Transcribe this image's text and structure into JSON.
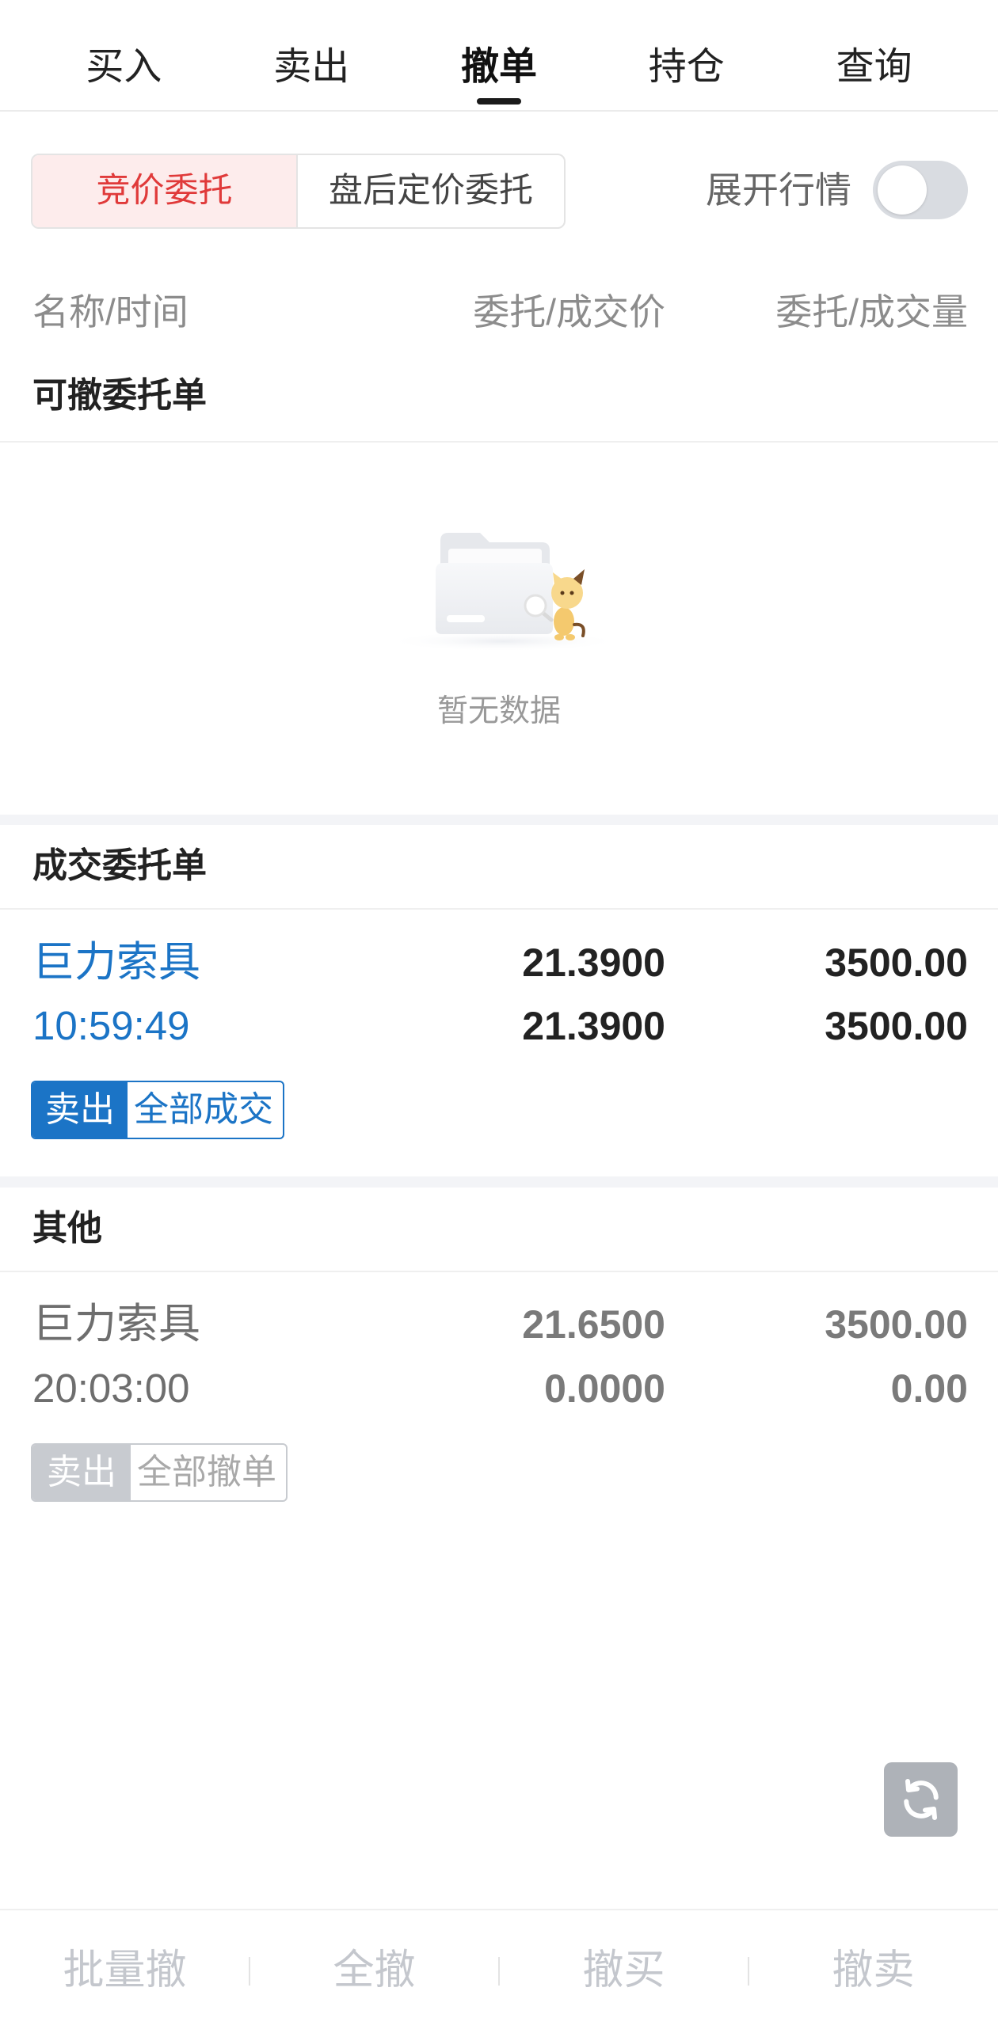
{
  "tabs": [
    {
      "label": "买入"
    },
    {
      "label": "卖出"
    },
    {
      "label": "撤单"
    },
    {
      "label": "持仓"
    },
    {
      "label": "查询"
    }
  ],
  "active_tab_index": 2,
  "order_type_segment": {
    "options": [
      "竞价委托",
      "盘后定价委托"
    ],
    "selected_index": 0
  },
  "market_toggle": {
    "label": "展开行情",
    "on": false
  },
  "columns": {
    "name_time": "名称/时间",
    "price": "委托/成交价",
    "volume": "委托/成交量"
  },
  "sections": {
    "cancelable": {
      "title": "可撤委托单",
      "empty_text": "暂无数据",
      "orders": []
    },
    "filled": {
      "title": "成交委托单",
      "orders": [
        {
          "name": "巨力索具",
          "time": "10:59:49",
          "order_price": "21.3900",
          "deal_price": "21.3900",
          "order_qty": "3500.00",
          "deal_qty": "3500.00",
          "side": "卖出",
          "status": "全部成交"
        }
      ]
    },
    "other": {
      "title": "其他",
      "orders": [
        {
          "name": "巨力索具",
          "time": "20:03:00",
          "order_price": "21.6500",
          "deal_price": "0.0000",
          "order_qty": "3500.00",
          "deal_qty": "0.00",
          "side": "卖出",
          "status": "全部撤单"
        }
      ]
    }
  },
  "bottom_actions": [
    {
      "label": "批量撤",
      "enabled": false
    },
    {
      "label": "全撤",
      "enabled": false
    },
    {
      "label": "撤买",
      "enabled": false
    },
    {
      "label": "撤卖",
      "enabled": false
    }
  ],
  "icons": {
    "refresh": "refresh-icon",
    "empty_state": "empty-folder-illustration"
  },
  "colors": {
    "accent_blue": "#1b74c6",
    "active_red": "#e03a3a",
    "active_red_bg": "#fdecec",
    "muted_gray": "#c8cbd0",
    "disabled_text": "#c4c7cd",
    "separator_band": "#f3f4f7"
  }
}
